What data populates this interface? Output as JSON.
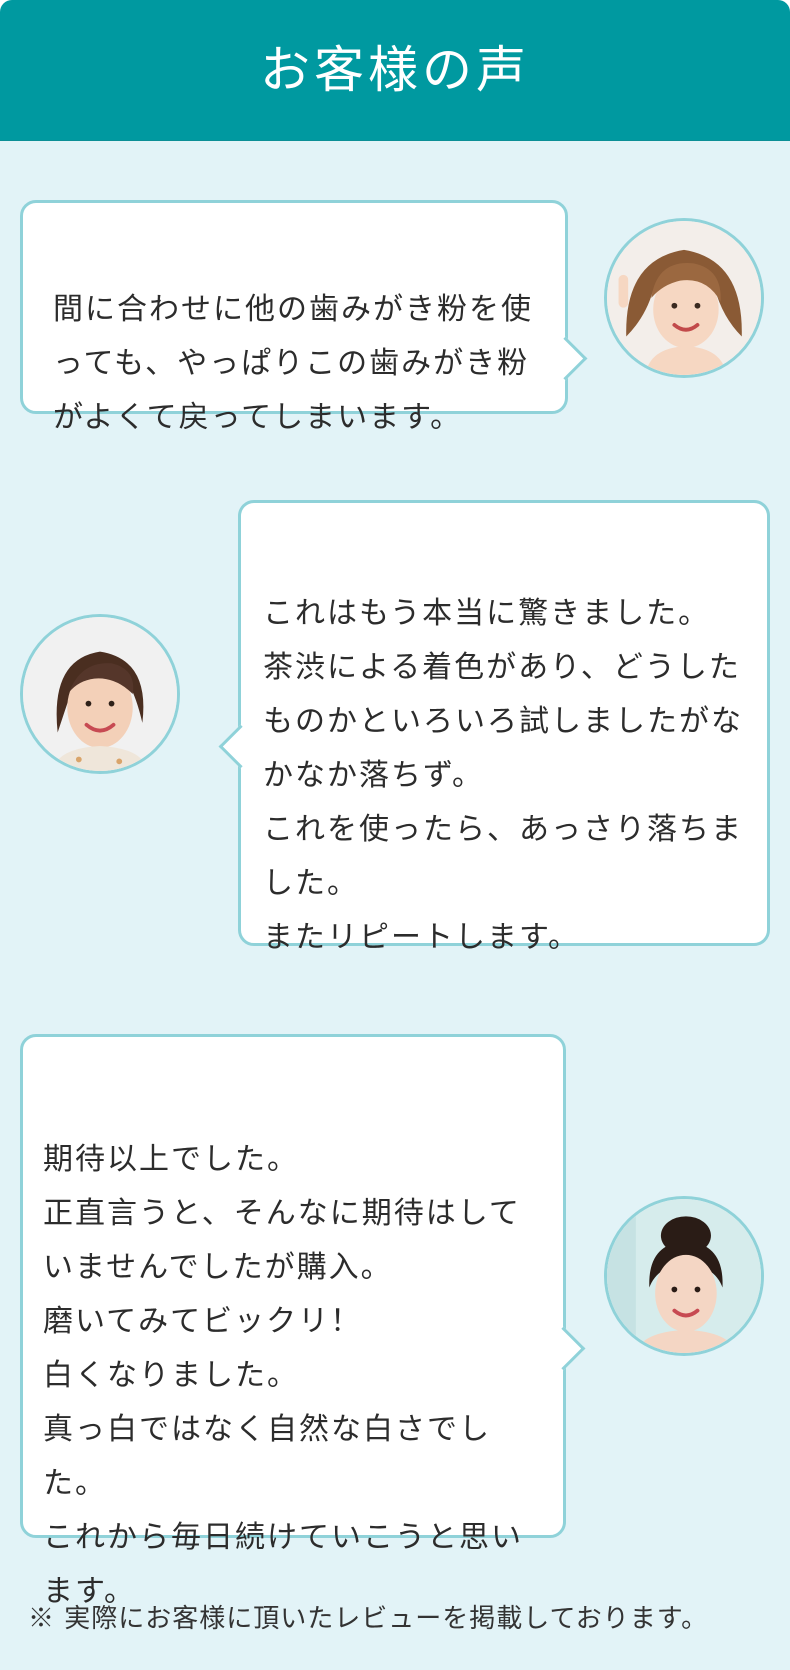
{
  "header": {
    "title": "お客様の声"
  },
  "testimonials": [
    {
      "text": "間に合わせに他の歯みがき粉を使っても、やっぱりこの歯みがき粉がよくて戻ってしまいます。",
      "avatar_icon": "customer-photo-1"
    },
    {
      "text": "これはもう本当に驚きました。\n茶渋による着色があり、どうしたものかといろいろ試しましたがなかなか落ちず。\nこれを使ったら、あっさり落ちました。\nまたリピートします。",
      "avatar_icon": "customer-photo-2"
    },
    {
      "text": "期待以上でした。\n正直言うと、そんなに期待はしていませんでしたが購入。\n磨いてみてビックリ！\n白くなりました。\n真っ白ではなく自然な白さでした。\nこれから毎日続けていこうと思います。",
      "avatar_icon": "customer-photo-3"
    }
  ],
  "footer": {
    "note": "※ 実際にお客様に頂いたレビューを掲載しております。"
  },
  "colors": {
    "header": "#0099a0",
    "background": "#e2f3f7",
    "border": "#8fd2d9"
  }
}
